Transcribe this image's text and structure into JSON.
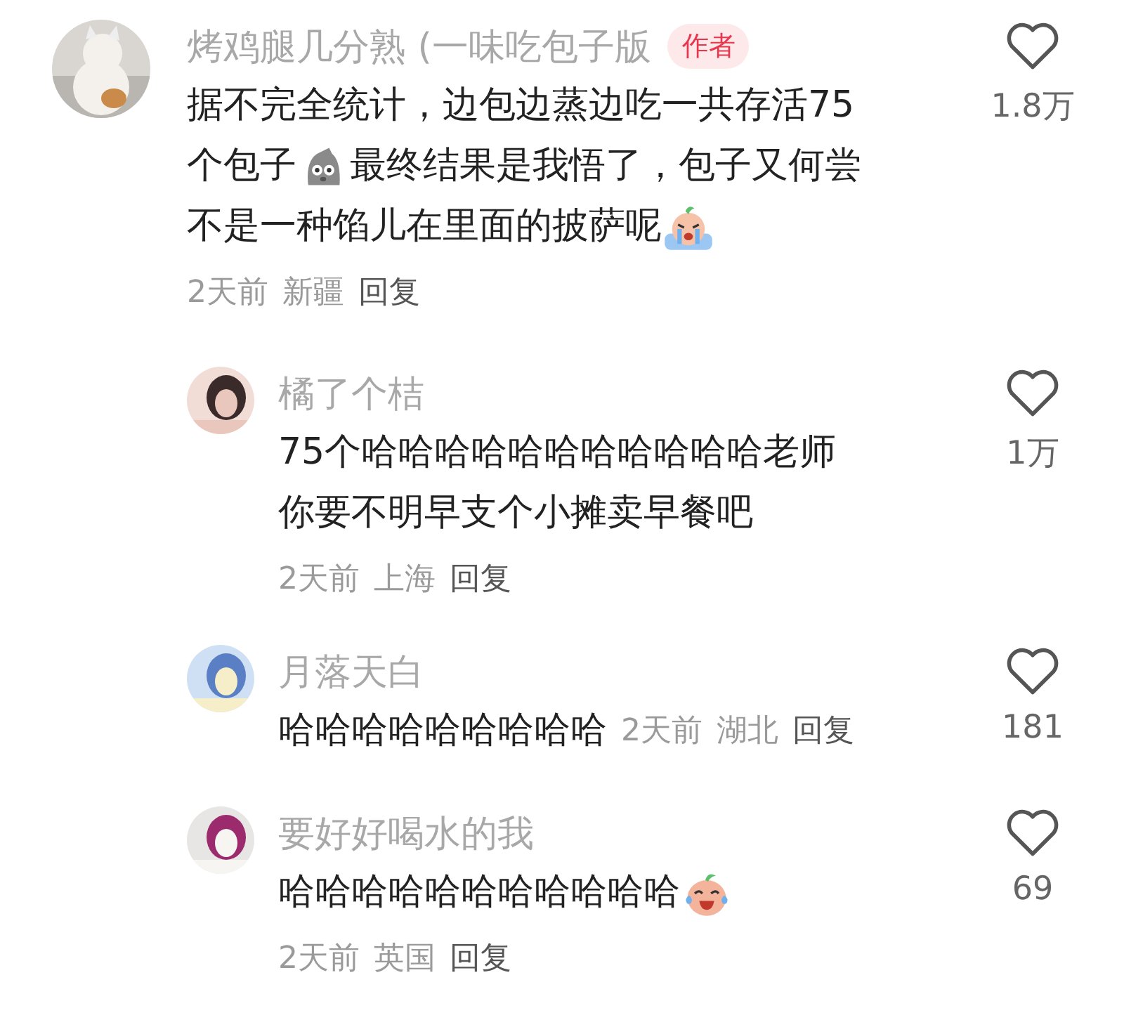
{
  "comments": [
    {
      "author": "烤鸡腿几分熟 (一味吃包子版",
      "badge": "作者",
      "lines": [
        [
          {
            "kind": "text",
            "text": "据不完全统计，边包边蒸边吃一共存活75"
          }
        ],
        [
          {
            "kind": "text",
            "text": "个包子"
          },
          {
            "kind": "ghost"
          },
          {
            "kind": "text",
            "text": "最终结果是我悟了，包子又何尝"
          }
        ],
        [
          {
            "kind": "text",
            "text": "不是一种馅儿在里面的披萨呢"
          },
          {
            "kind": "tears"
          }
        ]
      ],
      "time": "2天前",
      "place": "新疆",
      "reply": "回复",
      "likes": "1.8万",
      "meta_inline": false,
      "replies": [
        {
          "author": "橘了个桔",
          "lines": [
            [
              {
                "kind": "text",
                "text": "75个哈哈哈哈哈哈哈哈哈哈哈老师"
              }
            ],
            [
              {
                "kind": "text",
                "text": "你要不明早支个小摊卖早餐吧"
              }
            ]
          ],
          "time": "2天前",
          "place": "上海",
          "reply": "回复",
          "likes": "1万",
          "meta_inline": false
        },
        {
          "author": "月落天白",
          "lines": [
            [
              {
                "kind": "text",
                "text": "哈哈哈哈哈哈哈哈哈"
              }
            ]
          ],
          "time": "2天前",
          "place": "湖北",
          "reply": "回复",
          "likes": "181",
          "meta_inline": true
        },
        {
          "author": "要好好喝水的我",
          "lines": [
            [
              {
                "kind": "text",
                "text": "哈哈哈哈哈哈哈哈哈哈哈"
              },
              {
                "kind": "laughcry"
              }
            ]
          ],
          "time": "2天前",
          "place": "英国",
          "reply": "回复",
          "likes": "69",
          "meta_inline": false
        }
      ]
    }
  ]
}
